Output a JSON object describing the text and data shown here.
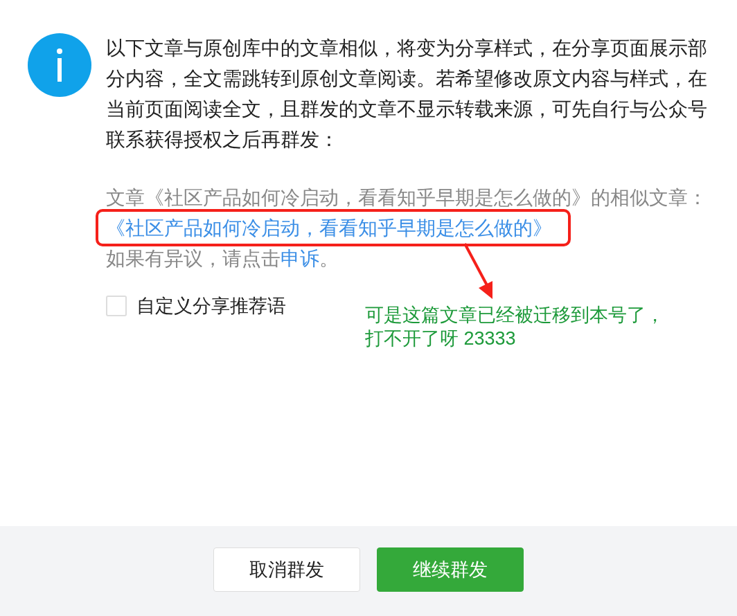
{
  "info_message": "以下文章与原创库中的文章相似，将变为分享样式，在分享页面展示部分内容，全文需跳转到原创文章阅读。若希望修改原文内容与样式，在当前页面阅读全文，且群发的文章不显示转载来源，可先自行与公众号联系获得授权之后再群发：",
  "similar": {
    "intro": "文章《社区产品如何冷启动，看看知乎早期是怎么做的》的相似文章：",
    "article_link": "《社区产品如何冷启动，看看知乎早期是怎么做的》",
    "dispute_prefix": "如果有异议，请点击",
    "appeal_link": "申诉",
    "dispute_suffix": "。"
  },
  "custom_share_text": {
    "label": "自定义分享推荐语",
    "checked": false
  },
  "annotation": {
    "note_lines": [
      "可是这篇文章已经被迁移到本号了，",
      "打不开了呀 23333"
    ]
  },
  "buttons": [
    {
      "label": "取消群发",
      "kind": "secondary"
    },
    {
      "label": "继续群发",
      "kind": "primary"
    }
  ]
}
